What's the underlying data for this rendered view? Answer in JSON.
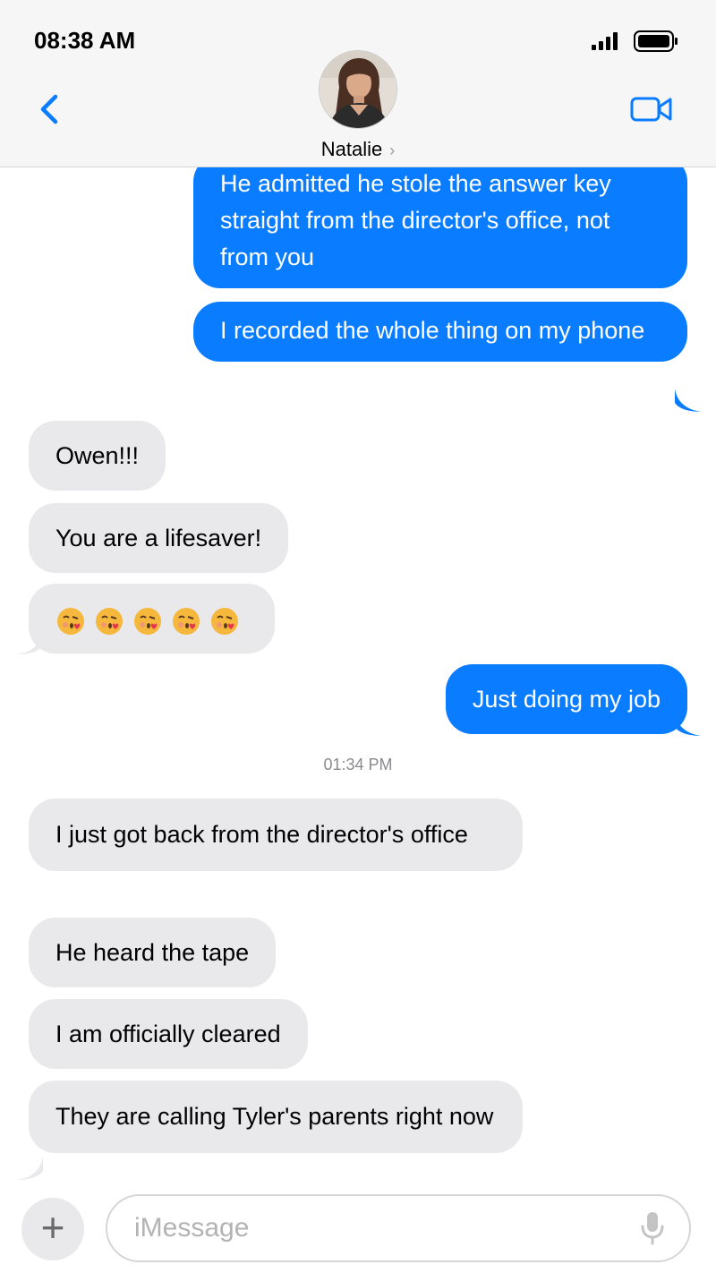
{
  "status_bar": {
    "time": "08:38 AM"
  },
  "header": {
    "contact_name": "Natalie",
    "chevron": "›"
  },
  "messages": [
    {
      "from": "me",
      "text": "He admitted he stole the answer key straight from the director's office, not from you"
    },
    {
      "from": "me",
      "text": "I recorded the whole thing on my phone"
    },
    {
      "from": "them",
      "text": "Owen!!!"
    },
    {
      "from": "them",
      "text": "You are a lifesaver!"
    },
    {
      "from": "them",
      "emoji": [
        "face-blowing-a-kiss",
        "face-blowing-a-kiss",
        "face-blowing-a-kiss",
        "face-blowing-a-kiss",
        "face-blowing-a-kiss"
      ]
    },
    {
      "from": "me",
      "text": "Just doing my job"
    },
    {
      "timestamp": "01:34 PM"
    },
    {
      "from": "them",
      "text": "I just got back from the director's office"
    },
    {
      "from": "them",
      "text": "He heard the tape"
    },
    {
      "from": "them",
      "text": "I am officially cleared"
    },
    {
      "from": "them",
      "text": "They are calling Tyler's parents right now"
    }
  ],
  "composer": {
    "placeholder": "iMessage",
    "plus_label": "+"
  },
  "icons": {
    "back": "chevron-left-icon",
    "video": "video-camera-icon",
    "mic": "microphone-icon",
    "signal": "cellular-signal-icon",
    "battery": "battery-icon"
  },
  "colors": {
    "accent": "#0a7cff",
    "incoming_bubble": "#e9e9eb",
    "header_bg": "#f6f6f6"
  }
}
